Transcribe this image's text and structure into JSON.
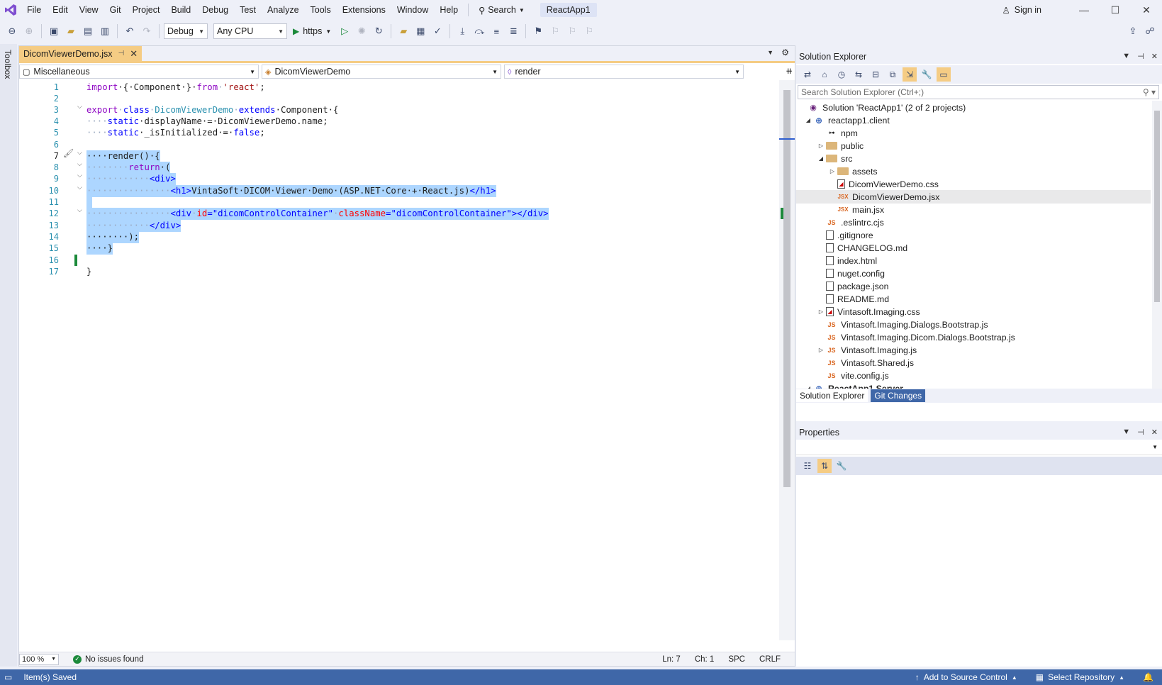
{
  "menubar": {
    "items": [
      "File",
      "Edit",
      "View",
      "Git",
      "Project",
      "Build",
      "Debug",
      "Test",
      "Analyze",
      "Tools",
      "Extensions",
      "Window",
      "Help"
    ],
    "search_label": "Search",
    "project_name": "ReactApp1",
    "sign_in": "Sign in"
  },
  "toolbar": {
    "config": "Debug",
    "platform": "Any CPU",
    "run_target": "https"
  },
  "toolbox_label": "Toolbox",
  "editor": {
    "tab_title": "DicomViewerDemo.jsx",
    "nav": {
      "project": "Miscellaneous",
      "type": "DicomViewerDemo",
      "member": "render"
    },
    "line_numbers": [
      "1",
      "2",
      "3",
      "4",
      "5",
      "6",
      "7",
      "8",
      "9",
      "10",
      "11",
      "12",
      "13",
      "14",
      "15",
      "16",
      "17"
    ],
    "code": {
      "l1_import": "import",
      "l1_rest": "·{·Component·}·",
      "l1_from": "from",
      "l1_str": "'react'",
      "l1_end": ";",
      "l3_export": "export",
      "l3_class": "class",
      "l3_name": "DicomViewerDemo",
      "l3_extends": "extends",
      "l3_rest": "·Component·{",
      "l4_ws": "····",
      "l4_static": "static",
      "l4_rest": "·displayName·=·DicomViewerDemo.name;",
      "l5_ws": "····",
      "l5_static": "static",
      "l5_rest": "·_isInitialized·=·",
      "l5_false": "false",
      "l5_end": ";",
      "l7": "····render()·{",
      "l8_ws": "········",
      "l8_return": "return",
      "l8_rest": "·(",
      "l9_ws": "············",
      "l9_tag": "<div>",
      "l10_ws": "················",
      "l10_open": "<h1>",
      "l10_text": "VintaSoft·DICOM·Viewer·Demo·(ASP.NET·Core·+·React.js)",
      "l10_close": "</h1>",
      "l12_ws": "················",
      "l12_open": "<div",
      "l12_attr1": "id",
      "l12_eq1": "=",
      "l12_val1": "\"dicomControlContainer\"",
      "l12_attr2": "className",
      "l12_eq2": "=",
      "l12_val2": "\"dicomControlContainer\"",
      "l12_close": "></div>",
      "l13_ws": "············",
      "l13_tag": "</div>",
      "l14": "········);",
      "l15": "····}",
      "l17": "}"
    },
    "zoom": "100 %",
    "issues": "No issues found",
    "position": {
      "line": "Ln: 7",
      "col": "Ch: 1",
      "indent": "SPC",
      "eol": "CRLF"
    }
  },
  "solution_explorer": {
    "title": "Solution Explorer",
    "search_placeholder": "Search Solution Explorer (Ctrl+;)",
    "tree": [
      {
        "label": "Solution 'ReactApp1' (2 of 2 projects)",
        "icon": "solution-icon",
        "expander": ""
      },
      {
        "label": "reactapp1.client",
        "icon": "web-project-icon",
        "expander": "◢"
      },
      {
        "label": "npm",
        "icon": "npm-icon",
        "expander": ""
      },
      {
        "label": "public",
        "icon": "folder-icon",
        "expander": "▷"
      },
      {
        "label": "src",
        "icon": "folder-icon",
        "expander": "◢"
      },
      {
        "label": "assets",
        "icon": "folder-icon",
        "expander": "▷"
      },
      {
        "label": "DicomViewerDemo.css",
        "icon": "css-file-icon",
        "expander": ""
      },
      {
        "label": "DicomViewerDemo.jsx",
        "icon": "jsx-file-icon",
        "expander": ""
      },
      {
        "label": "main.jsx",
        "icon": "jsx-file-icon",
        "expander": ""
      },
      {
        "label": ".eslintrc.cjs",
        "icon": "js-file-icon",
        "expander": ""
      },
      {
        "label": ".gitignore",
        "icon": "text-file-icon",
        "expander": ""
      },
      {
        "label": "CHANGELOG.md",
        "icon": "markdown-file-icon",
        "expander": ""
      },
      {
        "label": "index.html",
        "icon": "html-file-icon",
        "expander": ""
      },
      {
        "label": "nuget.config",
        "icon": "config-file-icon",
        "expander": ""
      },
      {
        "label": "package.json",
        "icon": "json-file-icon",
        "expander": ""
      },
      {
        "label": "README.md",
        "icon": "markdown-file-icon",
        "expander": ""
      },
      {
        "label": "Vintasoft.Imaging.css",
        "icon": "css-file-icon",
        "expander": "▷"
      },
      {
        "label": "Vintasoft.Imaging.Dialogs.Bootstrap.js",
        "icon": "js-file-icon",
        "expander": ""
      },
      {
        "label": "Vintasoft.Imaging.Dicom.Dialogs.Bootstrap.js",
        "icon": "js-file-icon",
        "expander": ""
      },
      {
        "label": "Vintasoft.Imaging.js",
        "icon": "js-file-icon",
        "expander": "▷"
      },
      {
        "label": "Vintasoft.Shared.js",
        "icon": "js-file-icon",
        "expander": ""
      },
      {
        "label": "vite.config.js",
        "icon": "js-file-icon",
        "expander": ""
      },
      {
        "label": "ReactApp1.Server",
        "icon": "web-project-icon",
        "expander": "◢"
      }
    ],
    "tabs": [
      "Solution Explorer",
      "Git Changes"
    ]
  },
  "properties": {
    "title": "Properties"
  },
  "statusbar": {
    "message": "Item(s) Saved",
    "add_to_source_control": "Add to Source Control",
    "select_repository": "Select Repository"
  }
}
